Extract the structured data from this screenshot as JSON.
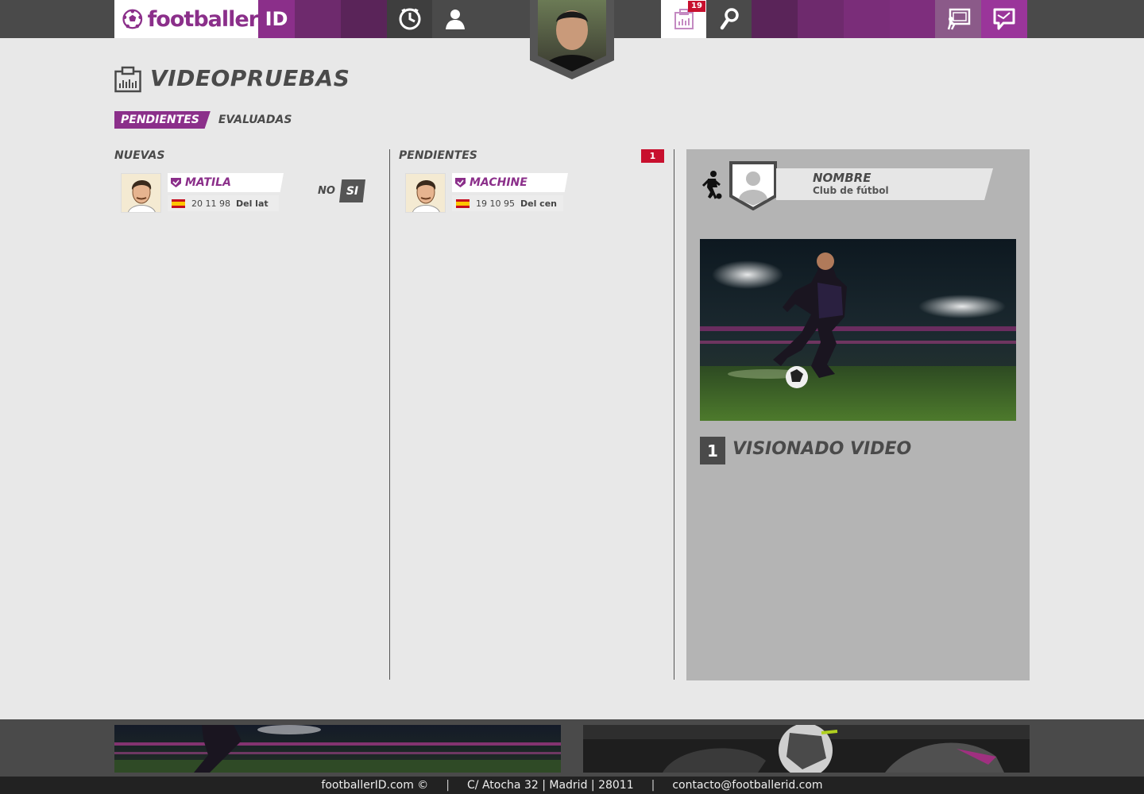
{
  "header": {
    "logo_text": "footballer",
    "logo_id": "ID",
    "notification_count": "19",
    "nav_icons": [
      "clock-ball-icon",
      "user-profile-icon",
      "clipboard-icon",
      "search-icon",
      "tactics-board-icon",
      "messages-icon"
    ]
  },
  "page": {
    "title": "VIDEOPRUEBAS",
    "tabs": [
      "PENDIENTES",
      "EVALUADAS"
    ]
  },
  "columns": {
    "nuevas": {
      "title": "NUEVAS",
      "player": {
        "name": "MATILA",
        "date": "20 11 98",
        "position": "Del lat"
      },
      "no_label": "NO",
      "si_label": "SI"
    },
    "pendientes": {
      "title": "PENDIENTES",
      "count": "1",
      "player": {
        "name": "MACHINE",
        "date": "19 10 95",
        "position": "Del cen"
      }
    }
  },
  "detail": {
    "name": "NOMBRE",
    "club": "Club de fútbol",
    "step_number": "1",
    "step_title": "VISIONADO VIDEO"
  },
  "footer": {
    "copyright": "footballerID.com ©",
    "address": "C/ Atocha 32 | Madrid | 28011",
    "email": "contacto@footballerid.com"
  },
  "colors": {
    "brand_purple": "#8b2f8a",
    "badge_red": "#c8102e",
    "dark_gray": "#4a4a4a"
  }
}
